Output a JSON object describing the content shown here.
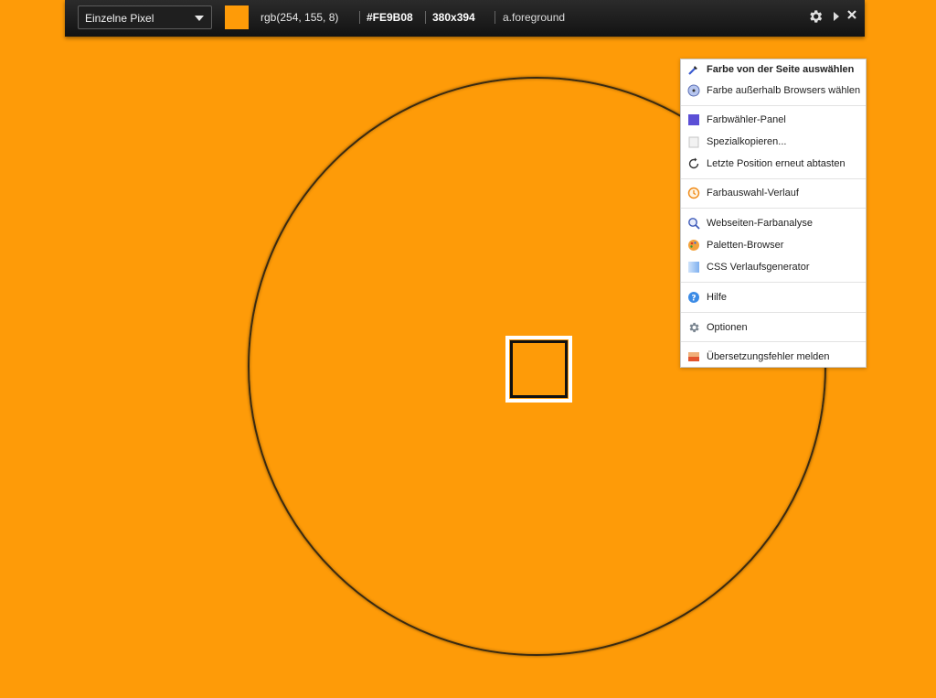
{
  "toolbar": {
    "mode_label": "Einzelne Pixel",
    "swatch_color": "#fe9b08",
    "rgb": "rgb(254, 155, 8)",
    "hex": "#FE9B08",
    "position": "380x394",
    "element": "a.foreground"
  },
  "menu": {
    "items": [
      {
        "label": "Farbe von der Seite auswählen",
        "icon": "eyedropper-icon"
      },
      {
        "label": "Farbe außerhalb Browsers wählen",
        "icon": "disc-icon"
      },
      {
        "label": "Farbwähler-Panel",
        "icon": "color-square-icon"
      },
      {
        "label": "Spezialkopieren...",
        "icon": "copy-icon"
      },
      {
        "label": "Letzte Position erneut abtasten",
        "icon": "refresh-icon"
      },
      {
        "label": "Farbauswahl-Verlauf",
        "icon": "history-clock-icon"
      },
      {
        "label": "Webseiten-Farbanalyse",
        "icon": "magnifier-icon"
      },
      {
        "label": "Paletten-Browser",
        "icon": "palette-icon"
      },
      {
        "label": "CSS Verlaufsgenerator",
        "icon": "gradient-icon"
      },
      {
        "label": "Hilfe",
        "icon": "help-icon"
      },
      {
        "label": "Optionen",
        "icon": "gear-icon"
      },
      {
        "label": "Übersetzungsfehler melden",
        "icon": "translate-flag-icon"
      }
    ]
  },
  "colors": {
    "page": "#fe9b08",
    "toolbar": "#1a1a1a"
  }
}
